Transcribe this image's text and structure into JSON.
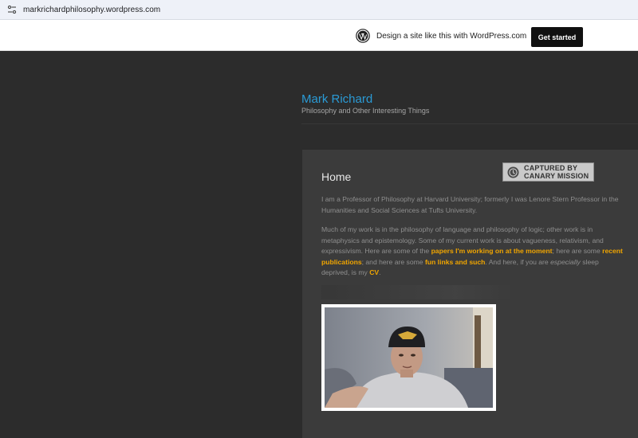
{
  "browser": {
    "url": "markrichardphilosophy.wordpress.com",
    "site_info_icon": "tune-icon"
  },
  "wp_banner": {
    "logo_icon": "wordpress-logo-icon",
    "text": "Design a site like this with WordPress.com",
    "button_label": "Get started"
  },
  "site": {
    "title": "Mark Richard",
    "tagline": "Philosophy and Other Interesting Things",
    "title_color": "#2a9bd6"
  },
  "watermark": {
    "line1": "CAPTURED BY",
    "line2": "CANARY MISSION",
    "icon": "clock-icon"
  },
  "page": {
    "title": "Home",
    "p1": "I am a Professor of Philosophy at Harvard University; formerly I was Lenore Stern Professor in the Humanities and Social Sciences at Tufts University.",
    "p2_a": "Much of my work is in the philosophy of language and philosophy of logic; other work is in metaphysics and epistemology.  Some of my current work is about vagueness, relativism, and expressivism.  Here are some of the ",
    "p2_link_papers": "papers I'm working on at the moment",
    "p2_b": "; here are some ",
    "p2_link_pubs": "recent publications",
    "p2_c": "; and here are some ",
    "p2_link_fun": "fun links and such",
    "p2_d": ".  And here, if you are ",
    "p2_em": "especially",
    "p2_e": " sleep deprived, is my ",
    "p2_link_cv": "CV",
    "p2_f": ".",
    "link_color": "#f0a500"
  },
  "photo": {
    "subject": "portrait photo of a man wearing a dark beanie"
  }
}
